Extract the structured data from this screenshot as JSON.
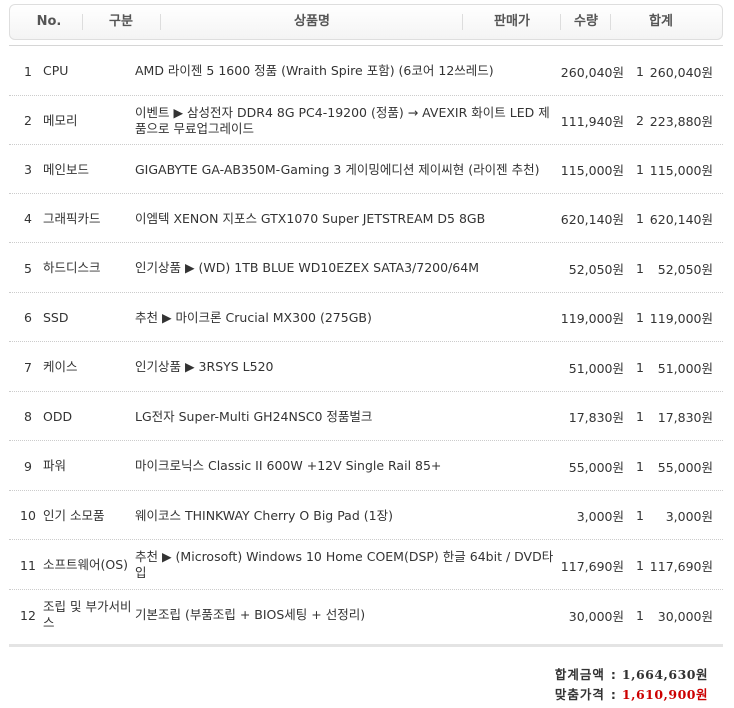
{
  "header": {
    "no": "No.",
    "category": "구분",
    "product": "상품명",
    "price": "판매가",
    "qty": "수량",
    "total": "합계"
  },
  "rows": [
    {
      "no": "1",
      "category": "CPU",
      "product": "AMD 라이젠 5 1600 정품 (Wraith Spire 포함) (6코어 12쓰레드)",
      "price": "260,040원",
      "qty": "1",
      "total": "260,040원"
    },
    {
      "no": "2",
      "category": "메모리",
      "product": "이벤트 ▶ 삼성전자 DDR4 8G PC4-19200 (정품) → AVEXIR 화이트 LED 제품으로 무료업그레이드",
      "price": "111,940원",
      "qty": "2",
      "total": "223,880원"
    },
    {
      "no": "3",
      "category": "메인보드",
      "product": "GIGABYTE GA-AB350M-Gaming 3 게이밍에디션 제이씨현 (라이젠 추천)",
      "price": "115,000원",
      "qty": "1",
      "total": "115,000원"
    },
    {
      "no": "4",
      "category": "그래픽카드",
      "product": "이엠텍 XENON 지포스 GTX1070 Super JETSTREAM D5 8GB",
      "price": "620,140원",
      "qty": "1",
      "total": "620,140원"
    },
    {
      "no": "5",
      "category": "하드디스크",
      "product": "인기상품 ▶ (WD) 1TB BLUE WD10EZEX SATA3/7200/64M",
      "price": "52,050원",
      "qty": "1",
      "total": "52,050원"
    },
    {
      "no": "6",
      "category": "SSD",
      "product": "추천 ▶ 마이크론 Crucial MX300 (275GB)",
      "price": "119,000원",
      "qty": "1",
      "total": "119,000원"
    },
    {
      "no": "7",
      "category": "케이스",
      "product": "인기상품 ▶ 3RSYS L520",
      "price": "51,000원",
      "qty": "1",
      "total": "51,000원"
    },
    {
      "no": "8",
      "category": "ODD",
      "product": "LG전자 Super-Multi GH24NSC0 정품벌크",
      "price": "17,830원",
      "qty": "1",
      "total": "17,830원"
    },
    {
      "no": "9",
      "category": "파워",
      "product": "마이크로닉스 Classic II 600W +12V Single Rail 85+",
      "price": "55,000원",
      "qty": "1",
      "total": "55,000원"
    },
    {
      "no": "10",
      "category": "인기 소모품",
      "product": "웨이코스 THINKWAY Cherry O Big Pad (1장)",
      "price": "3,000원",
      "qty": "1",
      "total": "3,000원"
    },
    {
      "no": "11",
      "category": "소프트웨어(OS)",
      "product": "추천 ▶ (Microsoft) Windows 10 Home COEM(DSP) 한글 64bit / DVD타입",
      "price": "117,690원",
      "qty": "1",
      "total": "117,690원"
    },
    {
      "no": "12",
      "category": "조립 및 부가서비스",
      "product": "기본조립 (부품조립 + BIOS세팅 + 선정리)",
      "price": "30,000원",
      "qty": "1",
      "total": "30,000원"
    }
  ],
  "summary": {
    "total_label": "합계금액",
    "total_value": "1,664,630원",
    "custom_label": "맞춤가격",
    "custom_value": "1,610,900원",
    "accent_color": "#cc0000"
  }
}
